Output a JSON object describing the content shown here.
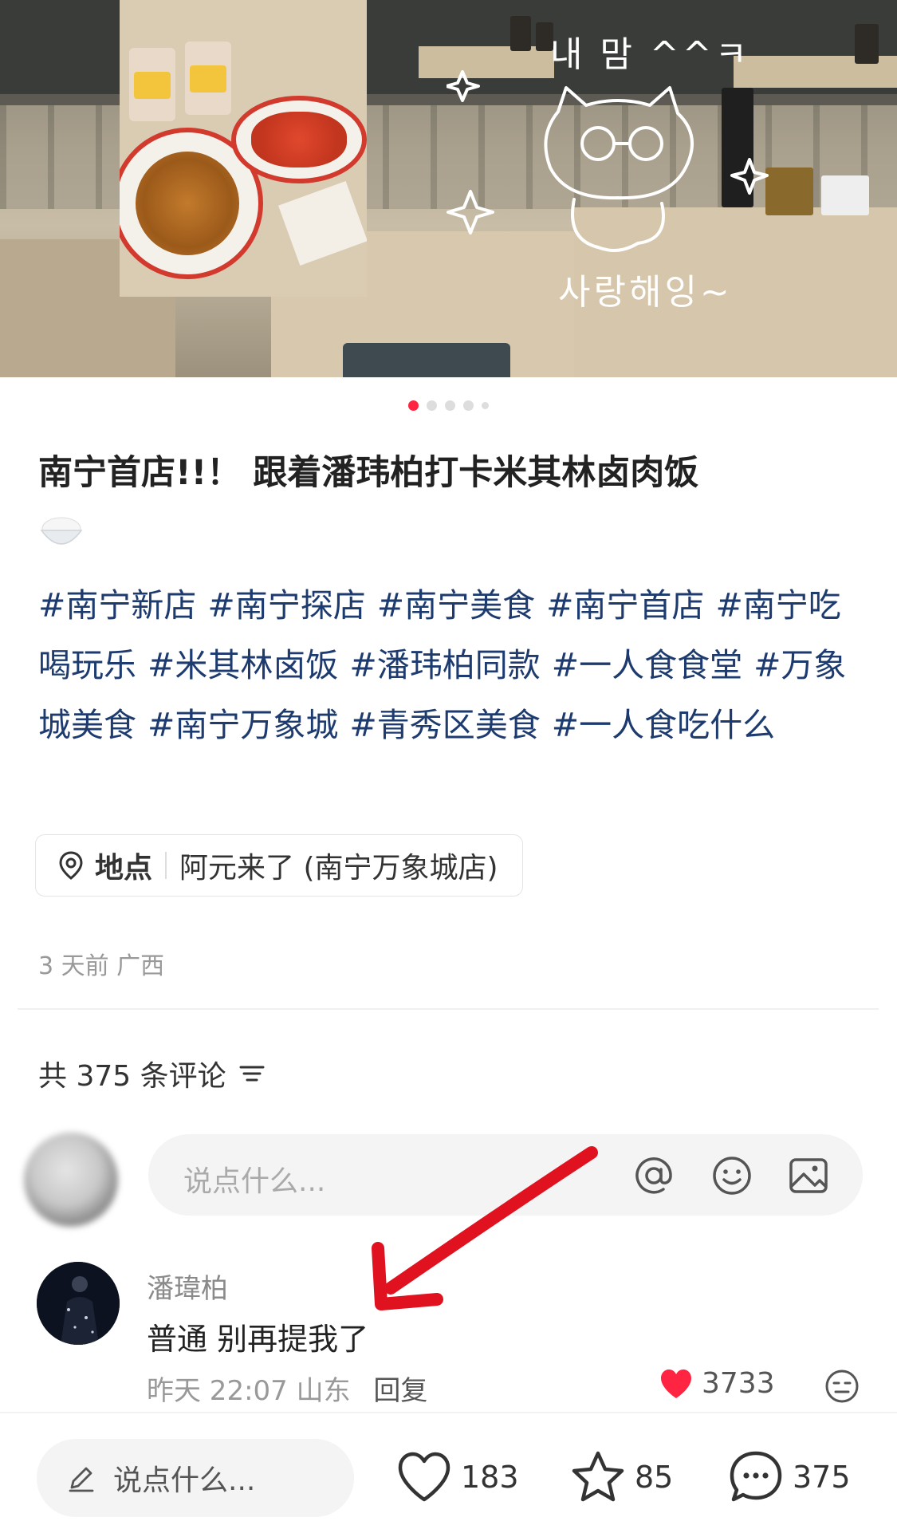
{
  "post": {
    "title": "南宁首店!!！ 跟着潘玮柏打卡米其林卤肉饭",
    "tags": [
      "#南宁新店",
      "#南宁探店",
      "#南宁美食",
      "#南宁首店",
      "#南宁吃喝玩乐",
      "#米其林卤饭",
      "#潘玮柏同款",
      "#一人食食堂",
      "#万象城美食",
      "#南宁万象城",
      "#青秀区美食",
      "#一人食吃什么"
    ],
    "location_label": "地点",
    "location_name": "阿元来了 (南宁万象城店)",
    "meta": "3 天前 广西",
    "image_pages": 5,
    "image_page_current": 1
  },
  "hero": {
    "doodle_text_top": "내 맘 ^^ㅋ",
    "doodle_text_bottom": "사랑해잉~"
  },
  "comments": {
    "count_label": "共 375 条评论",
    "input_placeholder": "说点什么...",
    "items": [
      {
        "name": "潘瑋柏",
        "text": "普通 别再提我了",
        "time": "昨天 22:07 山东",
        "reply_label": "回复",
        "likes": "3733"
      }
    ]
  },
  "bottom_bar": {
    "input_placeholder": "说点什么...",
    "likes": "183",
    "favorites": "85",
    "comments": "375"
  },
  "colors": {
    "accent": "#ff2442",
    "tag": "#1d3b6f",
    "arrow": "#e0121f"
  }
}
